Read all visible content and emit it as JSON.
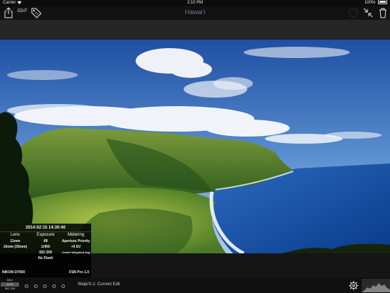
{
  "status": {
    "carrier": "Carrier",
    "time": "2:10 PM",
    "battery": "100%"
  },
  "toolbar": {
    "edit_label": "EDIT",
    "title": "Hawai'i"
  },
  "metadata": {
    "datetime": "2014:02:15 14:30:40",
    "columns": [
      {
        "header": "Lens",
        "values": [
          "11mm",
          "16mm (35mm)"
        ]
      },
      {
        "header": "Exposure",
        "values": [
          "f/8",
          "1/400",
          "ISO 200",
          "No Flash"
        ]
      },
      {
        "header": "Metering",
        "values": [
          "Aperture Priority",
          "+0 EV",
          "Center Weighted Avg"
        ]
      }
    ],
    "camera": "NIKON D7000",
    "firmware": "FSN Pro 1.0"
  },
  "filmstrip": {
    "thumb_lines": [
      "f/8.0",
      "1/400",
      "ISO 200"
    ],
    "edit_name": "Waipi'ō-1: Current Edit"
  },
  "colors": {
    "accent_title": "#6a7a95",
    "background": "#151515"
  }
}
